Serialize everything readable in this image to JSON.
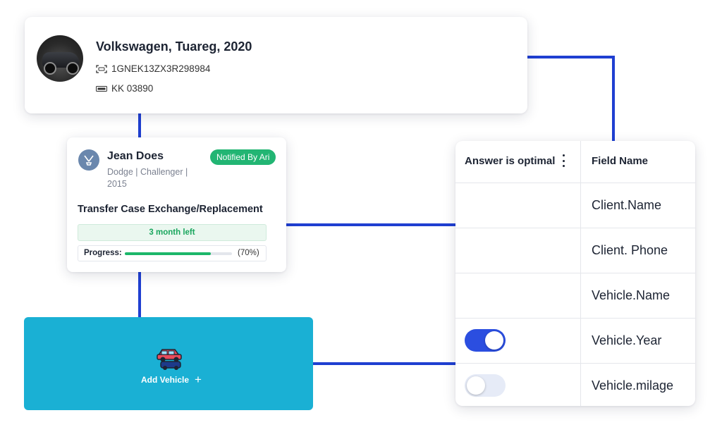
{
  "vehicle": {
    "title": "Volkswagen, Tuareg, 2020",
    "vin": "1GNEK13ZX3R298984",
    "plate": "KK 03890",
    "vin_icon": "vin-scan-icon",
    "plate_icon": "license-plate-icon"
  },
  "job": {
    "customer_name": "Jean Does",
    "vehicle_meta": "Dodge | Challenger | 2015",
    "badge": "Notified By Ari",
    "title": "Transfer Case Exchange/Replacement",
    "time_left": "3 month left",
    "progress_label": "Progress:",
    "progress_value": "(70%)",
    "progress_fraction": 0.8
  },
  "add_vehicle": {
    "label": "Add Vehicle",
    "plus": "+"
  },
  "field_table": {
    "headers": {
      "answer": "Answer is optimal",
      "field": "Field Name"
    },
    "rows": [
      {
        "field": "Client.Name",
        "toggle": null
      },
      {
        "field": "Client. Phone",
        "toggle": null
      },
      {
        "field": "Vehicle.Name",
        "toggle": null
      },
      {
        "field": "Vehicle.Year",
        "toggle": "on"
      },
      {
        "field": "Vehicle.milage",
        "toggle": "off"
      }
    ]
  },
  "colors": {
    "connector": "#1f3fd1",
    "add_vehicle_bg": "#1ab0d4",
    "badge_green": "#22b573",
    "toggle_on": "#2b4ee0",
    "toggle_off": "#e6ebf7"
  }
}
